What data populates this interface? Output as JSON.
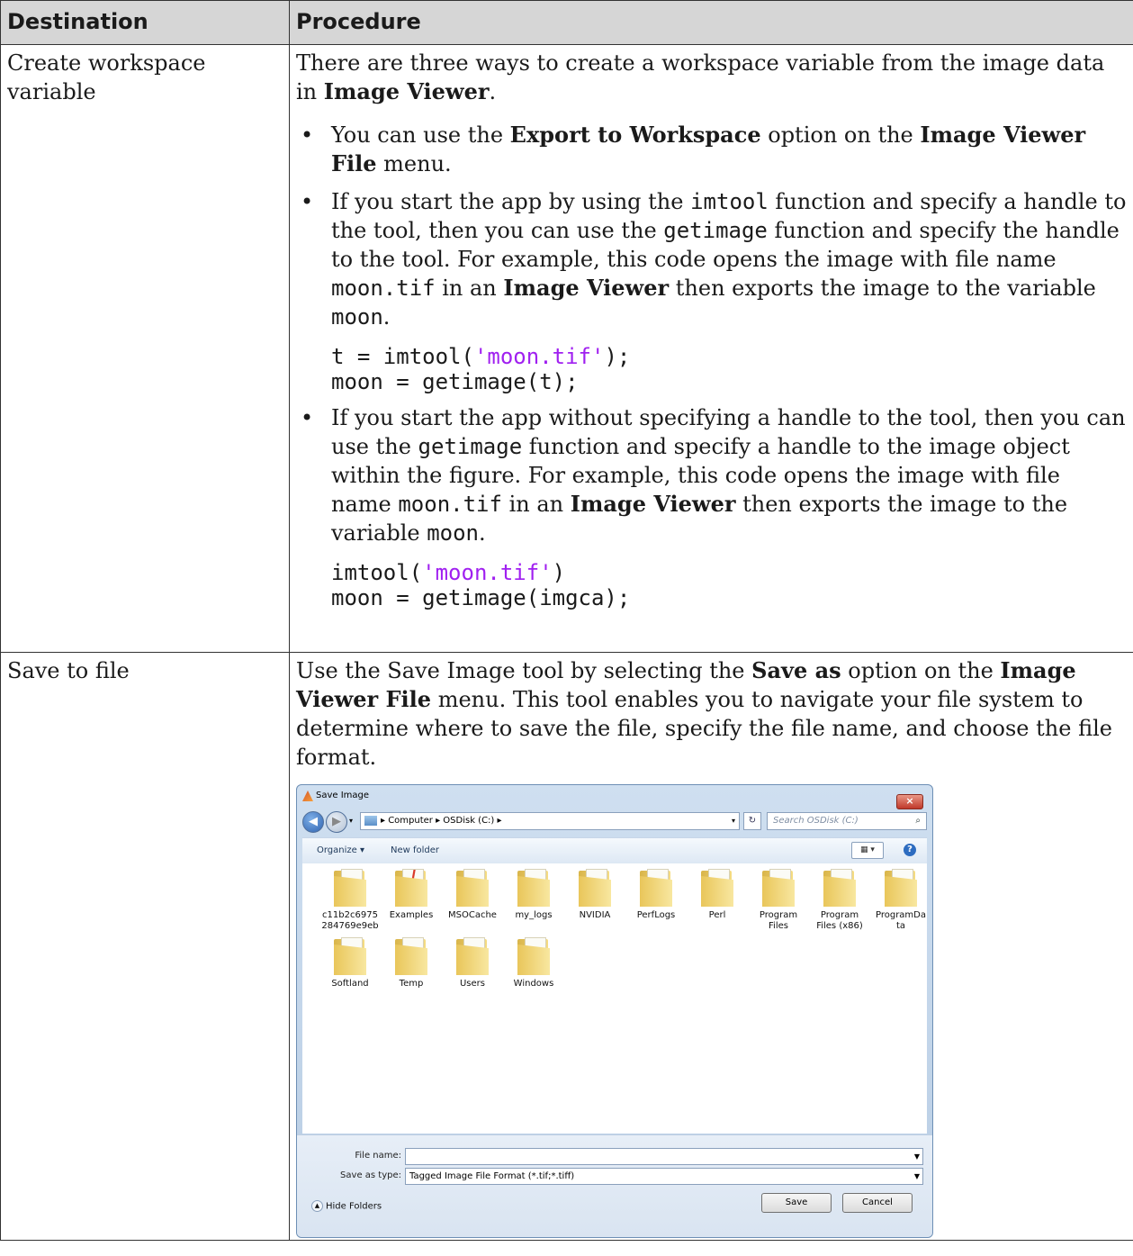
{
  "table": {
    "headers": {
      "destination": "Destination",
      "procedure": "Procedure"
    },
    "row1": {
      "destination": "Create workspace variable",
      "intro_a": "There are three ways to create a workspace variable from the image data in ",
      "intro_b": "Image Viewer",
      "intro_c": ".",
      "bullet1": {
        "a": "You can use the ",
        "b": "Export to Workspace",
        "c": " option on the ",
        "d": "Image Viewer File",
        "e": " menu."
      },
      "bullet2": {
        "a": "If you start the app by using the ",
        "b": "imtool",
        "c": " function and specify a handle to the tool, then you can use the ",
        "d": "getimage",
        "e": " function and specify the handle to the tool. For example, this code opens the image with file name ",
        "f": "moon.tif",
        "g": " in an ",
        "h": "Image Viewer",
        "i": " then exports the image to the variable ",
        "j": "moon",
        "k": ".",
        "code1_a": "t = imtool(",
        "code1_str": "'moon.tif'",
        "code1_b": ");",
        "code2": "moon = getimage(t);"
      },
      "bullet3": {
        "a": "If you start the app without specifying a handle to the tool, then you can use the ",
        "b": "getimage",
        "c": " function and specify a handle to the image object within the figure. For example, this code opens the image with file name ",
        "d": "moon.tif",
        "e": " in an ",
        "f": "Image Viewer",
        "g": " then exports the image to the variable ",
        "h": "moon",
        "i": ".",
        "code1_a": "imtool(",
        "code1_str": "'moon.tif'",
        "code1_b": ")",
        "code2": "moon = getimage(imgca);"
      }
    },
    "row2": {
      "destination": "Save to file",
      "p_a": "Use the Save Image tool by selecting the ",
      "p_b": "Save as",
      "p_c": " option on the ",
      "p_d": "Image Viewer File",
      "p_e": " menu. This tool enables you to navigate your file system to determine where to save the file, specify the file name, and choose the file format."
    }
  },
  "dialog": {
    "title": "Save Image",
    "close": "×",
    "path": "▸ Computer ▸ OSDisk (C:) ▸",
    "search_placeholder": "Search OSDisk (C:)",
    "organize": "Organize ▾",
    "new_folder": "New folder",
    "folders": [
      {
        "name": "c11b2c6975 284769e9eb"
      },
      {
        "name": "Examples"
      },
      {
        "name": "MSOCache"
      },
      {
        "name": "my_logs"
      },
      {
        "name": "NVIDIA"
      },
      {
        "name": "PerfLogs"
      },
      {
        "name": "Perl"
      },
      {
        "name": "Program Files"
      },
      {
        "name": "Program Files (x86)"
      },
      {
        "name": "ProgramDa ta"
      },
      {
        "name": "Softland"
      },
      {
        "name": "Temp"
      },
      {
        "name": "Users"
      },
      {
        "name": "Windows"
      }
    ],
    "file_name_label": "File name:",
    "file_name_value": "",
    "save_type_label": "Save as type:",
    "save_type_value": "Tagged Image File Format (*.tif;*.tiff)",
    "hide_folders": "Hide Folders",
    "save": "Save",
    "cancel": "Cancel"
  }
}
